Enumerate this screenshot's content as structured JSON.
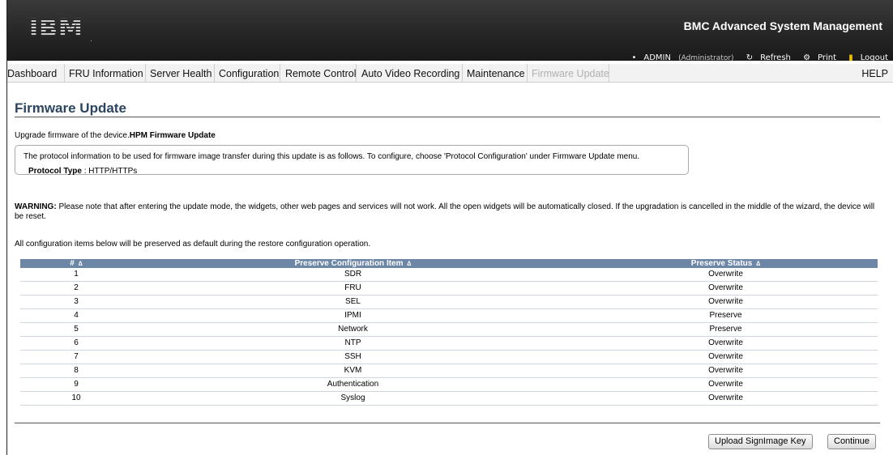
{
  "header": {
    "logo": "IBM",
    "title": "BMC Advanced System Management"
  },
  "status": {
    "user": "ADMIN",
    "role": "(Administrator)",
    "refresh": "Refresh",
    "print": "Print",
    "logout": "Logout",
    "icons": [
      "user-icon",
      "refresh-icon",
      "print-icon",
      "logout-icon"
    ]
  },
  "nav": {
    "items": [
      "Dashboard",
      "FRU Information",
      "Server Health",
      "Configuration",
      "Remote Control",
      "Auto Video Recording",
      "Maintenance",
      "Firmware Update"
    ],
    "active": "Firmware Update",
    "help": "HELP"
  },
  "page": {
    "title": "Firmware Update",
    "subtitle_prefix": "Upgrade firmware of the device.",
    "subtitle_bold": "HPM Firmware Update",
    "info_text": "The protocol information to be used for firmware image transfer during this update is as follows. To configure, choose 'Protocol Configuration' under Firmware Update menu.",
    "protocol_label": "Protocol Type",
    "protocol_value": ": HTTP/HTTPs",
    "warning_label": "WARNING:",
    "warning_text": "Please note that after entering the update mode, the widgets, other web pages and services will not work. All the open widgets will be automatically closed. If the upgradation is cancelled in the middle of the wizard, the device will be reset.",
    "note": "All configuration items below will be preserved as default during the restore configuration operation."
  },
  "table": {
    "headers": [
      "#",
      "Preserve Configuration Item",
      "Preserve Status"
    ],
    "sort_icon": "∆",
    "rows": [
      [
        "1",
        "SDR",
        "Overwrite"
      ],
      [
        "2",
        "FRU",
        "Overwrite"
      ],
      [
        "3",
        "SEL",
        "Overwrite"
      ],
      [
        "4",
        "IPMI",
        "Preserve"
      ],
      [
        "5",
        "Network",
        "Preserve"
      ],
      [
        "6",
        "NTP",
        "Overwrite"
      ],
      [
        "7",
        "SSH",
        "Overwrite"
      ],
      [
        "8",
        "KVM",
        "Overwrite"
      ],
      [
        "9",
        "Authentication",
        "Overwrite"
      ],
      [
        "10",
        "Syslog",
        "Overwrite"
      ]
    ]
  },
  "buttons": {
    "upload": "Upload SignImage Key",
    "continue": "Continue"
  },
  "colors": {
    "header_bg": "#262626",
    "table_header": "#6d86a6",
    "title": "#2c4560"
  }
}
